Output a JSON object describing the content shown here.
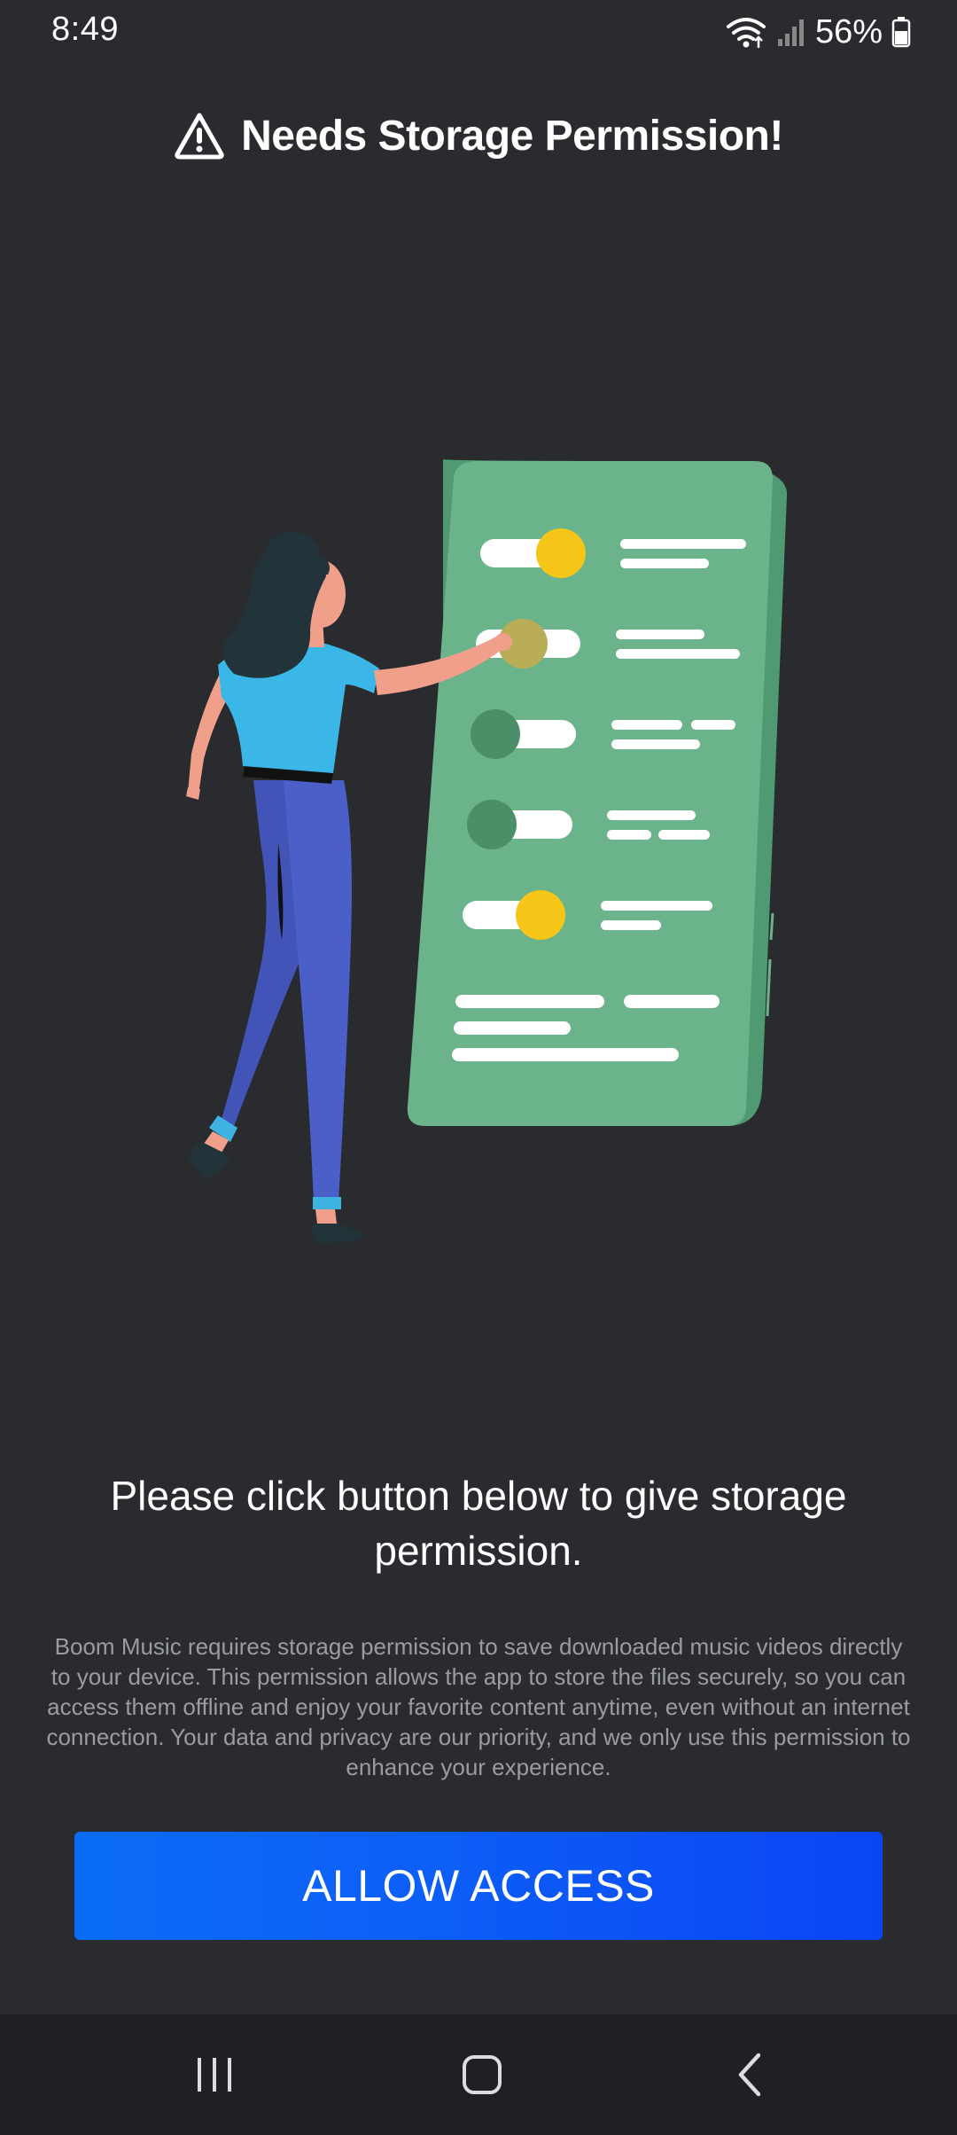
{
  "status_bar": {
    "time": "8:49",
    "battery_percent": "56%",
    "icons": [
      "wifi-icon",
      "signal-icon",
      "battery-icon"
    ]
  },
  "header": {
    "icon": "warning-icon",
    "title": "Needs Storage Permission!"
  },
  "illustration": {
    "description_icon": "permission-toggles-illustration",
    "toggles_on": [
      true,
      false,
      false,
      false,
      true
    ]
  },
  "main": {
    "headline": "Please click button below to give storage permission.",
    "description": "Boom Music requires storage permission to save downloaded music videos directly to your device. This permission allows the app to store the files securely, so you can access them offline and enjoy your favorite content anytime, even without an internet connection. Your data and privacy are our priority, and we only use this permission to enhance your experience.",
    "button_label": "ALLOW ACCESS"
  },
  "nav_bar": {
    "items": [
      "recent-apps-icon",
      "home-icon",
      "back-icon"
    ]
  },
  "colors": {
    "background": "#2a2b2f",
    "accent": "#0d5ef7",
    "phone_green": "#6bb38b",
    "toggle_on": "#f5c518"
  }
}
